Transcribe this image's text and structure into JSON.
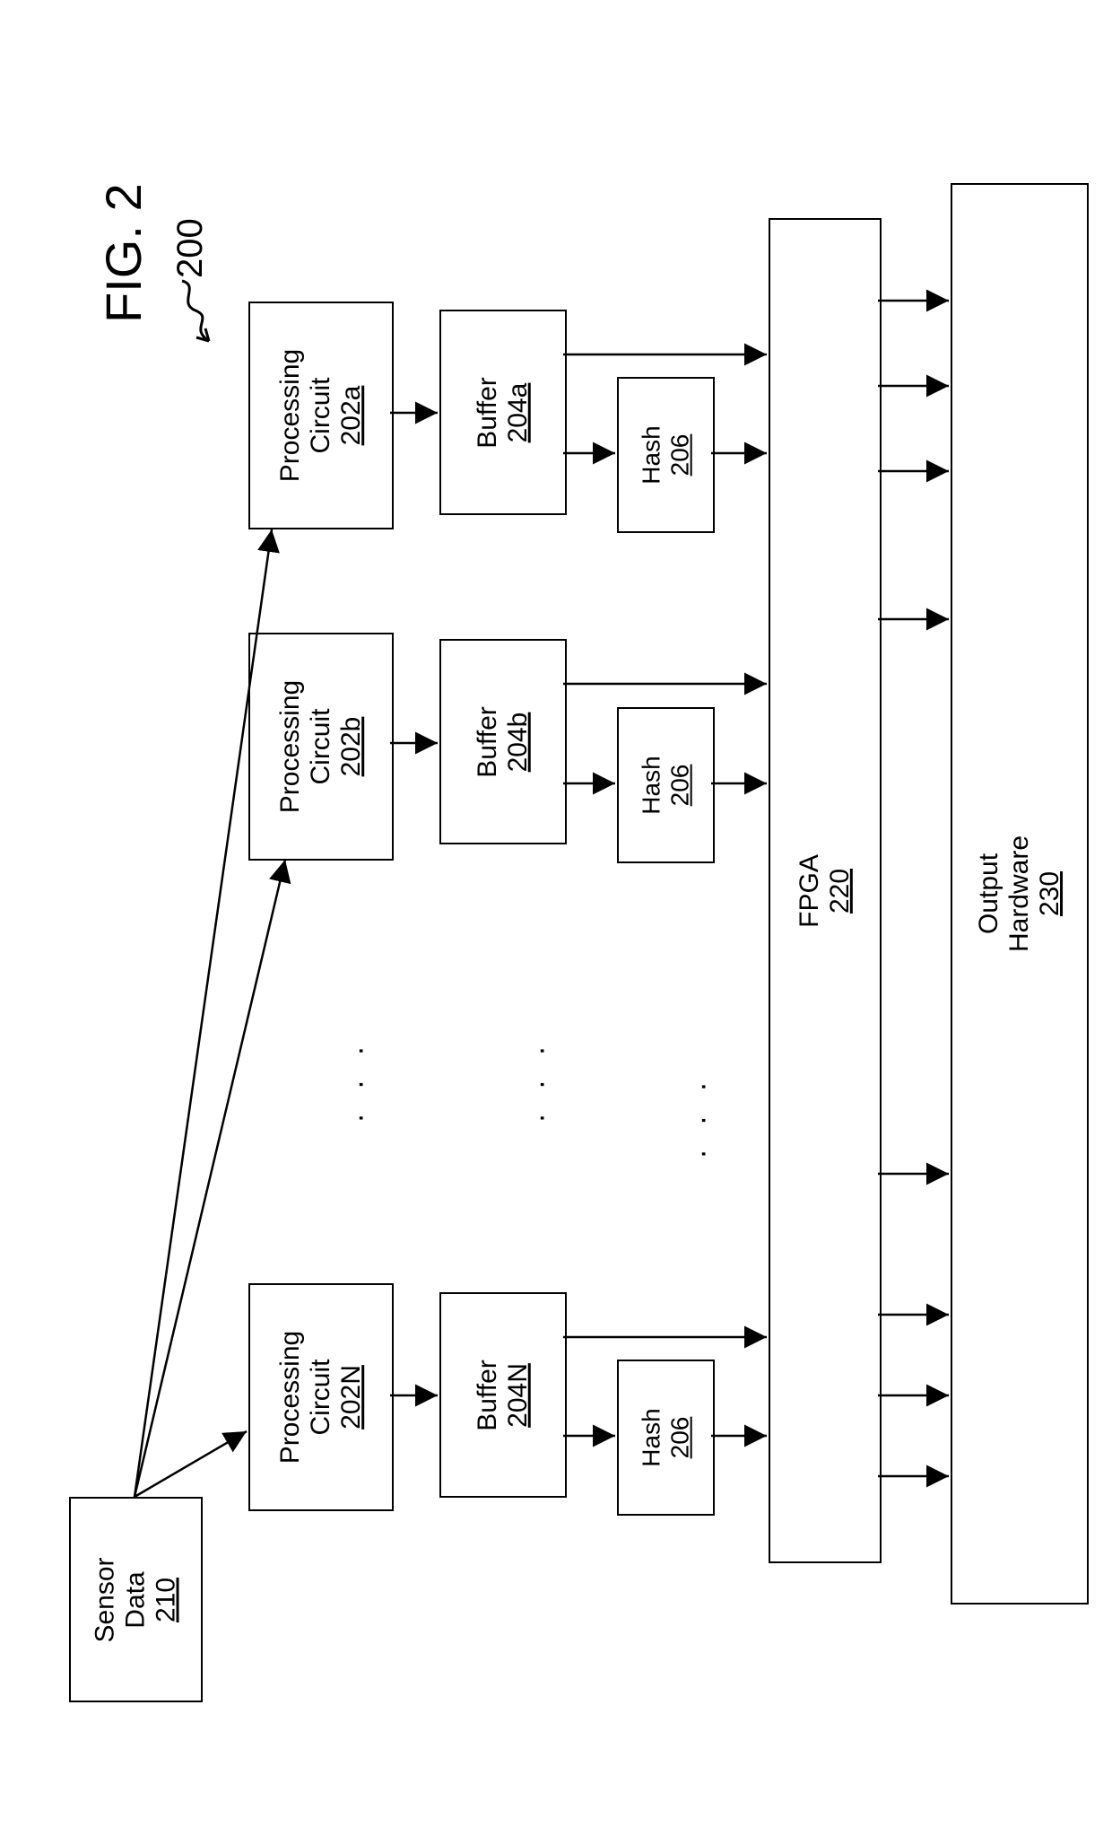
{
  "figure": {
    "title": "FIG. 2",
    "ref": "200"
  },
  "blocks": {
    "sensor": {
      "line1": "Sensor",
      "line2": "Data",
      "num": "210"
    },
    "pca": {
      "line1": "Processing",
      "line2": "Circuit",
      "num": "202a"
    },
    "pcb": {
      "line1": "Processing",
      "line2": "Circuit",
      "num": "202b"
    },
    "pcn": {
      "line1": "Processing",
      "line2": "Circuit",
      "num": "202N"
    },
    "bfa": {
      "line1": "Buffer",
      "num": "204a"
    },
    "bfb": {
      "line1": "Buffer",
      "num": "204b"
    },
    "bfn": {
      "line1": "Buffer",
      "num": "204N"
    },
    "hsa": {
      "line1": "Hash",
      "num": "206"
    },
    "hsb": {
      "line1": "Hash",
      "num": "206"
    },
    "hsn": {
      "line1": "Hash",
      "num": "206"
    },
    "fpga": {
      "line1": "FPGA",
      "num": "220"
    },
    "out": {
      "line1": "Output",
      "line2": "Hardware",
      "num": "230"
    }
  }
}
